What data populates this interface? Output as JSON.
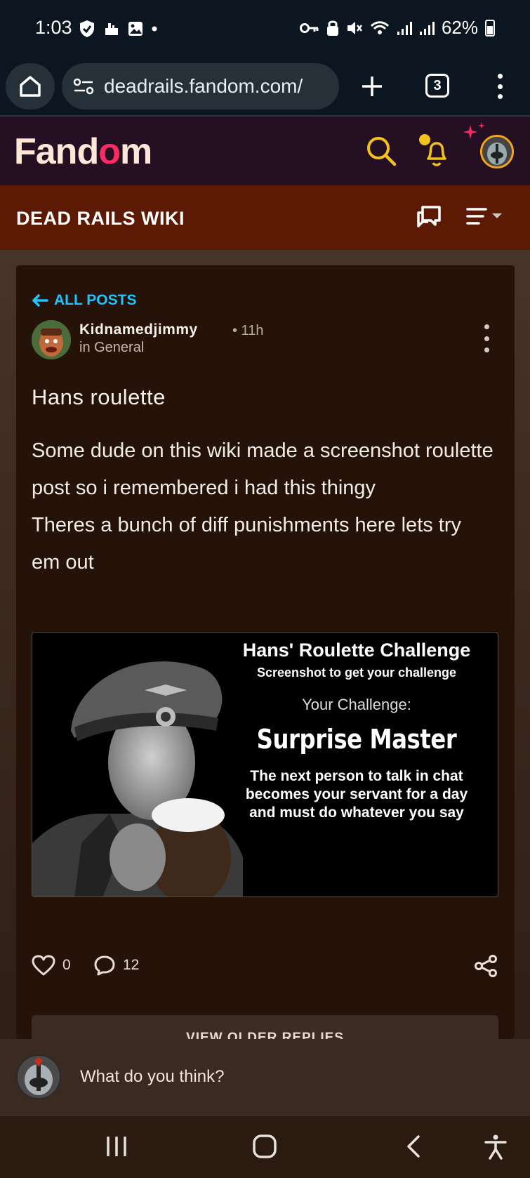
{
  "status": {
    "time": "1:03",
    "battery": "62%"
  },
  "browser": {
    "url": "deadrails.fandom.com/",
    "tab_count": "3"
  },
  "fandom": {
    "logo_left": "Fand",
    "logo_flame": "o",
    "logo_right": "m"
  },
  "wiki": {
    "title": "DEAD RAILS WIKI"
  },
  "post": {
    "back_label": "ALL POSTS",
    "author": "Kidnamedjimmy",
    "time": "• 11h",
    "category": "in General",
    "title": "Hans roulette",
    "body_line1": "Some dude on this wiki made a screenshot roulette post so i remembered i had this thingy",
    "body_line2": "Theres a bunch of diff punishments here lets try em out",
    "image": {
      "title": "Hans' Roulette Challenge",
      "subtitle": "Screenshot to get your challenge",
      "your_challenge": "Your Challenge:",
      "challenge_name": "Surprise Master",
      "description": "The next person to talk in chat becomes your servant for a day and must do whatever you say"
    },
    "likes": "0",
    "comments": "12",
    "older_replies_label": "VIEW OLDER REPLIES"
  },
  "reply": {
    "placeholder": "What do you think?"
  },
  "colors": {
    "accent_blue": "#1ec3ff",
    "fandom_yellow": "#f3c21a",
    "fandom_pink": "#ff2a63",
    "wiki_bar": "#5c1a04"
  },
  "icons": [
    "home-icon",
    "site-settings-icon",
    "plus-icon",
    "tabs-icon",
    "kebab-icon",
    "search-icon",
    "bell-icon",
    "discussions-icon",
    "hamburger-icon",
    "arrow-left-icon",
    "heart-icon",
    "comment-icon",
    "share-icon",
    "recents-icon",
    "home-nav-icon",
    "back-icon",
    "accessibility-icon"
  ]
}
